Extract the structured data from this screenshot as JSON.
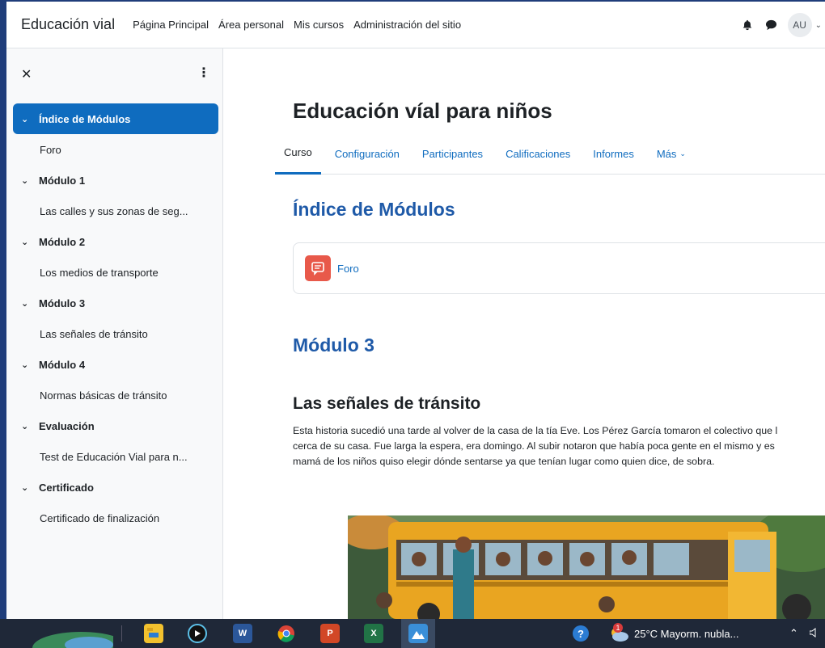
{
  "navbar": {
    "brand": "Educación vial",
    "links": [
      "Página Principal",
      "Área personal",
      "Mis cursos",
      "Administración del sitio"
    ],
    "user_initials": "AU"
  },
  "drawer": {
    "items": [
      {
        "kind": "section",
        "label": "Índice de Módulos",
        "active": true
      },
      {
        "kind": "item",
        "label": "Foro"
      },
      {
        "kind": "section",
        "label": "Módulo 1"
      },
      {
        "kind": "item",
        "label": "Las calles y sus zonas de seg..."
      },
      {
        "kind": "section",
        "label": "Módulo 2"
      },
      {
        "kind": "item",
        "label": "Los medios de transporte"
      },
      {
        "kind": "section",
        "label": "Módulo 3"
      },
      {
        "kind": "item",
        "label": "Las señales de tránsito"
      },
      {
        "kind": "section",
        "label": "Módulo 4"
      },
      {
        "kind": "item",
        "label": "Normas básicas de tránsito"
      },
      {
        "kind": "section",
        "label": "Evaluación"
      },
      {
        "kind": "item",
        "label": "Test de Educación Vial para n..."
      },
      {
        "kind": "section",
        "label": "Certificado"
      },
      {
        "kind": "item",
        "label": "Certificado de finalización"
      }
    ]
  },
  "main": {
    "course_title": "Educación víal para niños",
    "tabs": [
      {
        "label": "Curso",
        "active": true
      },
      {
        "label": "Configuración"
      },
      {
        "label": "Participantes"
      },
      {
        "label": "Calificaciones"
      },
      {
        "label": "Informes"
      },
      {
        "label": "Más"
      }
    ],
    "section_index_title": "Índice de Módulos",
    "activity_label": "Foro",
    "section_module_title": "Módulo 3",
    "lesson_title": "Las señales de tránsito",
    "lesson_lines": [
      "Esta historia sucedió una tarde al volver de la casa de la tía Eve. Los Pérez García tomaron el colectivo que l",
      "cerca de su casa. Fue larga la espera, era domingo. Al subir notaron que había poca gente en el mismo y es",
      "mamá de los niños quiso elegir dónde sentarse ya que tenían lugar como quien dice, de sobra."
    ]
  },
  "taskbar": {
    "weather": "25°C  Mayorm. nubla...",
    "weather_badge": "1"
  },
  "colors": {
    "primary": "#0f6cbf",
    "section_heading": "#1f5aa8",
    "forum_icon": "#e8594a",
    "taskbar": "#1f2838"
  }
}
